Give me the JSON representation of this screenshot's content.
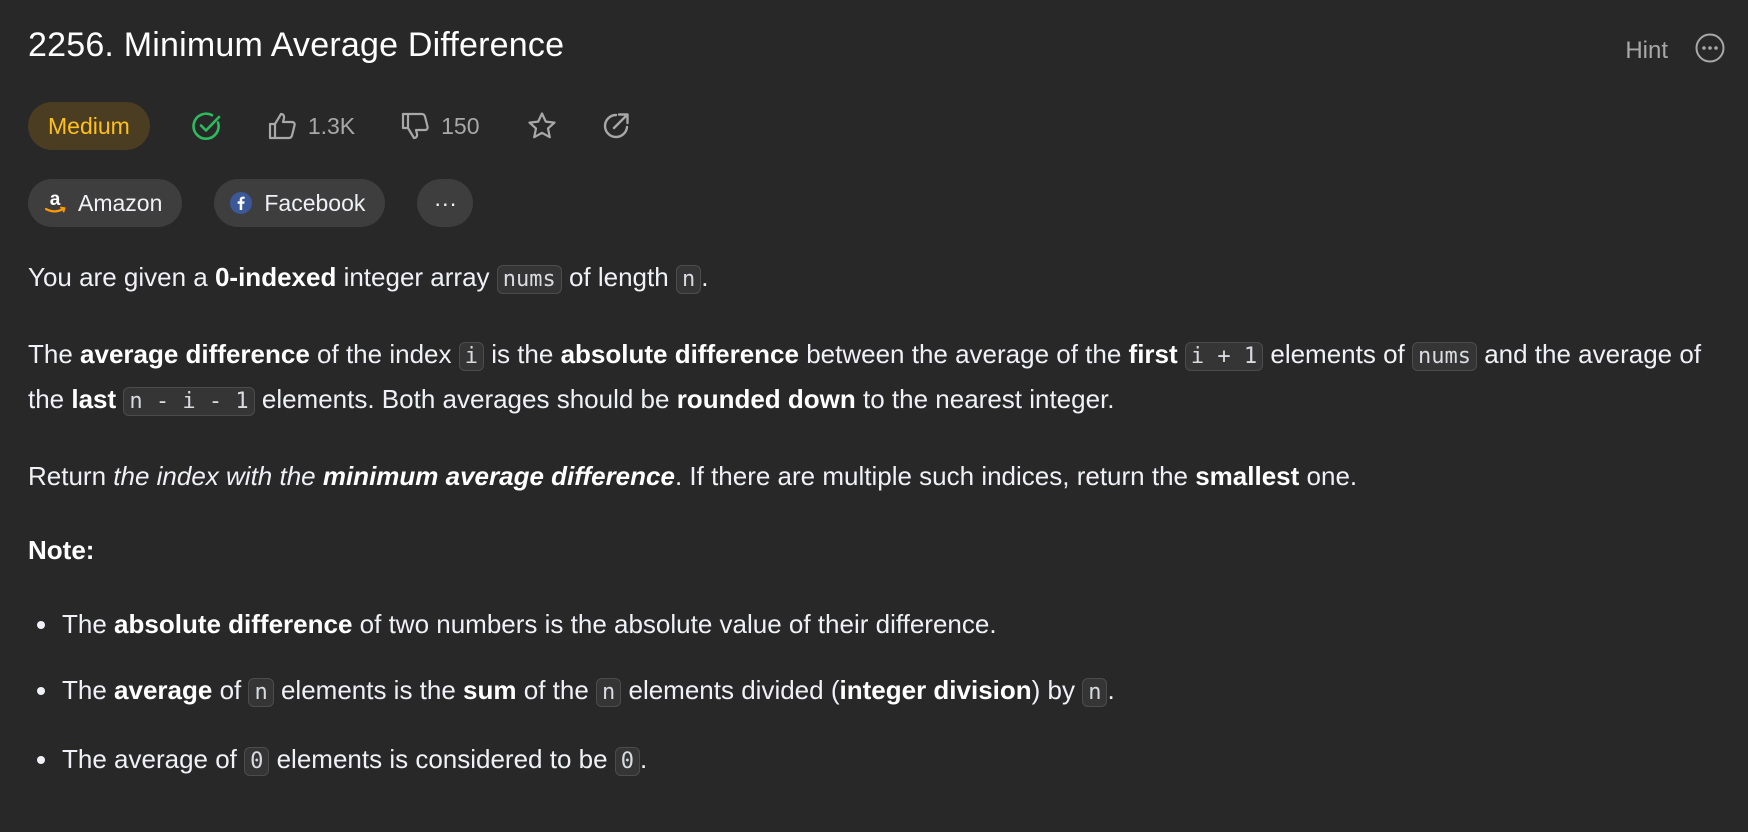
{
  "problem": {
    "title": "2256. Minimum Average Difference",
    "difficulty": "Medium",
    "likes": "1.3K",
    "dislikes": "150"
  },
  "header": {
    "hint_label": "Hint"
  },
  "companies": [
    {
      "name": "Amazon",
      "icon": "amazon-logo"
    },
    {
      "name": "Facebook",
      "icon": "facebook-logo"
    }
  ],
  "more_label": "···",
  "description": {
    "p1": {
      "t1": "You are given a ",
      "b1": "0-indexed",
      "t2": " integer array ",
      "c1": "nums",
      "t3": " of length ",
      "c2": "n",
      "t4": "."
    },
    "p2": {
      "t1": "The ",
      "b1": "average difference",
      "t2": " of the index ",
      "c1": "i",
      "t3": " is the ",
      "b2": "absolute difference",
      "t4": " between the average of the ",
      "b3": "first",
      "t5": " ",
      "c2": "i + 1",
      "t6": " elements of ",
      "c3": "nums",
      "t7": " and the average of the ",
      "b4": "last",
      "t8": " ",
      "c4": "n - i - 1",
      "t9": " elements. Both averages should be ",
      "b5": "rounded down",
      "t10": " to the nearest integer."
    },
    "p3": {
      "t1": "Return ",
      "i1": "the index with the ",
      "bi1": "minimum average difference",
      "t2": ". If there are multiple such indices, return the ",
      "b1": "smallest",
      "t3": " one."
    },
    "note_title": "Note:",
    "notes": [
      {
        "t1": "The ",
        "b1": "absolute difference",
        "t2": " of two numbers is the absolute value of their difference."
      },
      {
        "t1": "The ",
        "b1": "average",
        "t2": " of ",
        "c1": "n",
        "t3": " elements is the ",
        "b2": "sum",
        "t4": " of the ",
        "c2": "n",
        "t5": " elements divided (",
        "b3": "integer division",
        "t6": ") by ",
        "c3": "n",
        "t7": "."
      },
      {
        "t1": "The average of ",
        "c1": "0",
        "t2": " elements is considered to be ",
        "c2": "0",
        "t3": "."
      }
    ]
  },
  "colors": {
    "background": "#282828",
    "difficulty_text": "#ffc01e",
    "difficulty_bg": "#4a3d21",
    "solved_check": "#2cbb5d",
    "facebook_blue": "#3b5998",
    "amazon_orange": "#ff9900"
  }
}
